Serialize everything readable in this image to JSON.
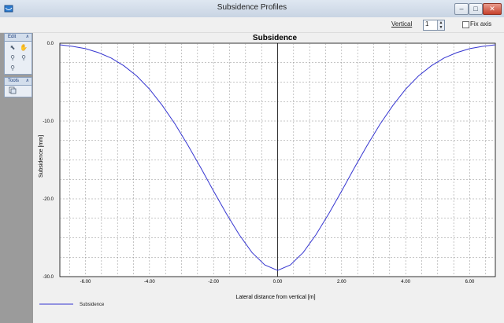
{
  "window": {
    "title": "Subsidence Profiles",
    "minimize": "–",
    "maximize": "□",
    "close": "✕"
  },
  "toolbar": {
    "vertical_label": "Vertical",
    "vertical_value": "1",
    "spin_up": "▲",
    "spin_down": "▼",
    "fix_axis_label": "Fix axis",
    "fix_axis_checked": false
  },
  "sidepanel": {
    "groups": [
      {
        "title": "Edit",
        "chevron": "∧",
        "tools": [
          "pointer-icon",
          "hand-pan-icon",
          "zoom-in-icon",
          "zoom-out-icon",
          "zoom-extents-icon"
        ]
      },
      {
        "title": "Tools",
        "chevron": "∧",
        "tools": [
          "copy-icon"
        ]
      }
    ]
  },
  "colors": {
    "series": "#3535d0",
    "grid": "#8c8c8c",
    "axis": "#000000"
  },
  "chart_data": {
    "type": "line",
    "title": "Subsidence",
    "xlabel": "Lateral distance from vertical [m]",
    "ylabel": "Subsidence [mm]",
    "xlim": [
      -6.8,
      6.8
    ],
    "ylim": [
      -30.0,
      0.0
    ],
    "x_ticks": [
      {
        "value": -6.0,
        "label": "-6.00"
      },
      {
        "value": -4.0,
        "label": "-4.00"
      },
      {
        "value": -2.0,
        "label": "-2.00"
      },
      {
        "value": 0.0,
        "label": "0.00"
      },
      {
        "value": 2.0,
        "label": "2.00"
      },
      {
        "value": 4.0,
        "label": "4.00"
      },
      {
        "value": 6.0,
        "label": "6.00"
      }
    ],
    "y_ticks": [
      {
        "value": 0.0,
        "label": "0.0"
      },
      {
        "value": -10.0,
        "label": "-10.0"
      },
      {
        "value": -20.0,
        "label": "-20.0"
      },
      {
        "value": -30.0,
        "label": "-30.0"
      }
    ],
    "grid": true,
    "legend_position": "bottom-left",
    "series": [
      {
        "name": "Subsidence",
        "x": [
          -6.8,
          -6.4,
          -6.0,
          -5.6,
          -5.2,
          -4.8,
          -4.4,
          -4.0,
          -3.6,
          -3.2,
          -2.8,
          -2.4,
          -2.0,
          -1.6,
          -1.2,
          -0.8,
          -0.4,
          0.0,
          0.4,
          0.8,
          1.2,
          1.6,
          2.0,
          2.4,
          2.8,
          3.2,
          3.6,
          4.0,
          4.4,
          4.8,
          5.2,
          5.6,
          6.0,
          6.4,
          6.8
        ],
        "y": [
          -0.2,
          -0.4,
          -0.7,
          -1.2,
          -1.9,
          -2.9,
          -4.2,
          -5.9,
          -8.0,
          -10.4,
          -13.1,
          -16.0,
          -19.0,
          -21.9,
          -24.6,
          -26.9,
          -28.5,
          -29.2,
          -28.5,
          -26.9,
          -24.6,
          -21.9,
          -19.0,
          -16.0,
          -13.1,
          -10.4,
          -8.0,
          -5.9,
          -4.2,
          -2.9,
          -1.9,
          -1.2,
          -0.7,
          -0.4,
          -0.2
        ]
      }
    ]
  }
}
